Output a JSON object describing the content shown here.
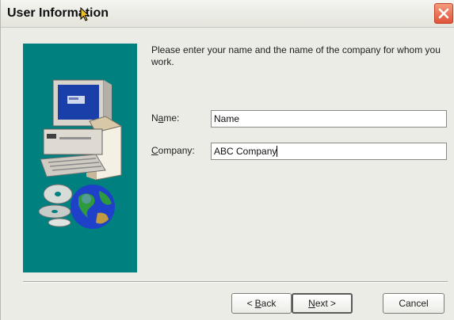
{
  "window": {
    "title": "User Information"
  },
  "content": {
    "instruction": "Please enter your name and the name of the company for whom you work."
  },
  "form": {
    "name": {
      "label_underlined": "a",
      "label_before": "N",
      "label_after": "me:",
      "value": "Name"
    },
    "company": {
      "label_underlined": "C",
      "label_before": "",
      "label_after": "ompany:",
      "value": "ABC Company"
    }
  },
  "buttons": {
    "back": {
      "prefix": "<",
      "underlined": "B",
      "rest": "ack"
    },
    "next": {
      "underlined": "N",
      "rest": "ext",
      "suffix": ">"
    },
    "cancel": {
      "label": "Cancel"
    }
  },
  "icons": {
    "close": "close-x-icon",
    "artwork": "computer-and-globe-illustration",
    "cursor": "mouse-pointer-icon"
  },
  "colors": {
    "artwork_background": "#00807f",
    "close_button": "#e0543a"
  }
}
